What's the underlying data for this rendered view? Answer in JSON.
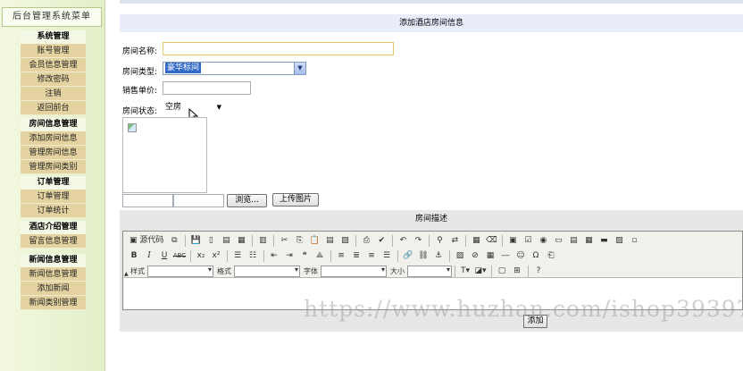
{
  "sidebar": {
    "title": "后台管理系统菜单",
    "sections": [
      {
        "heading": "系统管理",
        "items": [
          "账号管理",
          "会员信息管理",
          "修改密码",
          "注销",
          "返回前台"
        ]
      },
      {
        "heading": "房间信息管理",
        "items": [
          "添加房间信息",
          "管理房间信息",
          "管理房间类别"
        ]
      },
      {
        "heading": "订单管理",
        "items": [
          "订单管理",
          "订单统计"
        ]
      },
      {
        "heading": "酒店介绍管理",
        "items": [
          "留言信息管理"
        ]
      },
      {
        "heading": "新闻信息管理",
        "items": [
          "新闻信息管理",
          "添加新闻",
          "新闻类别管理"
        ]
      }
    ]
  },
  "header": {
    "title": "添加酒店房间信息"
  },
  "form": {
    "room_name_label": "房间名称:",
    "room_name_value": "",
    "room_type_label": "房间类型:",
    "room_type_selected": "豪华标间",
    "price_label": "销售单价:",
    "price_value": "",
    "status_label": "房间状态:",
    "status_selected": "空房",
    "browse_button": "浏览...",
    "upload_button": "上传图片",
    "description_label": "房间描述",
    "submit_button": "添加"
  },
  "editor": {
    "source_button": "源代码",
    "style_label": "样式",
    "format_label": "格式",
    "font_label": "字体",
    "size_label": "大小",
    "bold": "B",
    "italic": "I",
    "underline": "U",
    "strike": "ABC"
  },
  "watermark": "https://www.huzhan.com/ishop39397",
  "colors": {
    "sidebar_item_bg": "#e4d3a0",
    "header_bg": "#e9ecf9",
    "select_highlight": "#316ac5"
  }
}
